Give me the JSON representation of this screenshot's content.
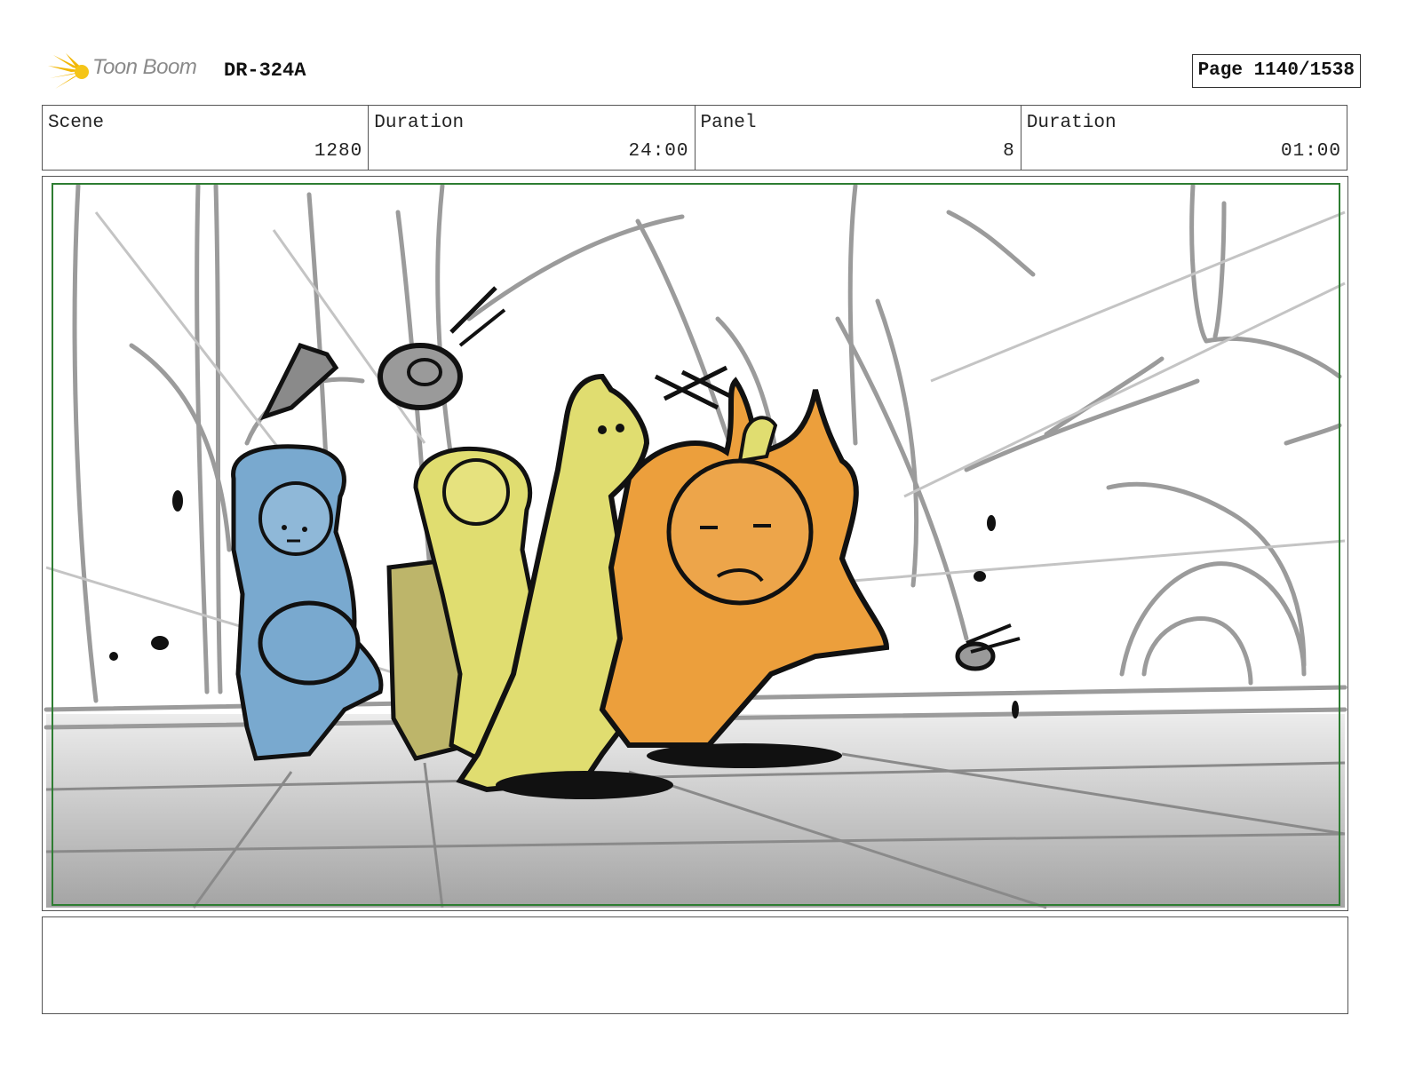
{
  "header": {
    "logo_text": "Toon Boom",
    "board_id": "DR-324A",
    "page": "Page 1140/1538"
  },
  "info": {
    "scene_label": "Scene",
    "scene_value": "1280",
    "duration_label": "Duration",
    "duration_value": "24:00",
    "panel_label": "Panel",
    "panel_value": "8",
    "panel_duration_label": "Duration",
    "panel_duration_value": "01:00"
  },
  "panel_image": {
    "description_icon": "storyboard-sketch-icon",
    "colors": {
      "frame": "#2e7d32",
      "blue_character": "#79a9cf",
      "yellow_character": "#e0dd70",
      "orange_creature": "#ec9f3c",
      "sketch_lines": "#9e9e9e"
    }
  },
  "notes": {
    "text": ""
  }
}
